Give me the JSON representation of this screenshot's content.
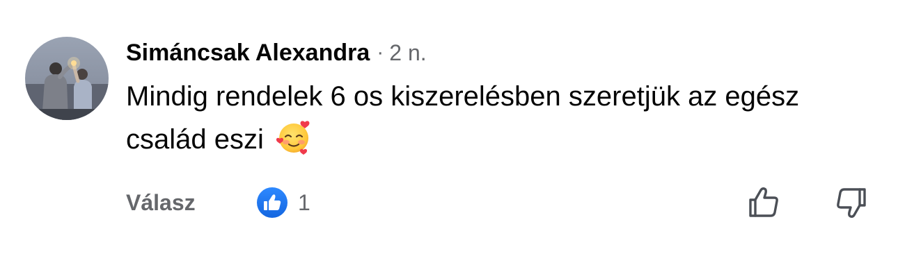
{
  "comment": {
    "author": "Simáncsak Alexandra",
    "separator": "·",
    "timestamp": "2 n.",
    "text": "Mindig rendelek 6 os kiszerelésben szeretjük az egész család eszi",
    "emoji": "smiling-face-with-hearts"
  },
  "actions": {
    "reply_label": "Válasz",
    "reaction_icon": "like-icon",
    "reaction_count": "1",
    "upvote_icon": "thumbs-up-outline-icon",
    "downvote_icon": "thumbs-down-outline-icon"
  },
  "colors": {
    "text_primary": "#050505",
    "text_secondary": "#65676b",
    "like_blue": "#1877f2",
    "background": "#ffffff"
  }
}
